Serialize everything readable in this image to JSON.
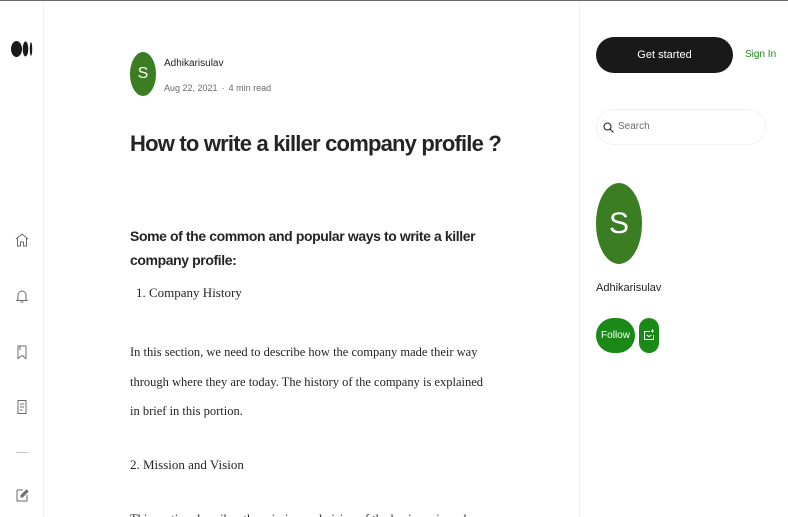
{
  "article": {
    "author": "Adhikarisulav",
    "author_initial": "S",
    "date": "Aug 22, 2021",
    "separator": "·",
    "read_time": "4 min read",
    "title": "How to write a killer company profile ?",
    "subheading": "Some of the common and popular ways to write a killer company profile:",
    "list_item_1": "1. Company History",
    "paragraph_1": "In this section, we need to describe how the company made their way through where they are today. The history of the company is explained in brief in this portion.",
    "section_2": "2. Mission and Vision",
    "truncated_line": "This section describes the mission and vision of the business in a clear and concise way"
  },
  "sidebar": {
    "get_started": "Get started",
    "sign_in": "Sign In",
    "search_placeholder": "Search",
    "author_name": "Adhikarisulav",
    "author_initial": "S",
    "follow": "Follow"
  },
  "colors": {
    "accent_green": "#1a8917",
    "avatar_green": "#3b7d23",
    "button_dark": "#191919"
  },
  "icons": [
    "medium-logo-icon",
    "home-icon",
    "notifications-icon",
    "bookmark-icon",
    "stories-icon",
    "write-icon",
    "search-icon",
    "subscribe-mail-icon"
  ]
}
